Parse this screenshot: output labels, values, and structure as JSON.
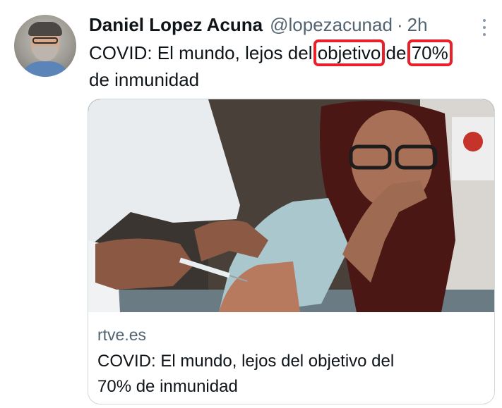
{
  "tweet": {
    "author": {
      "display_name": "Daniel Lopez Acuna",
      "handle": "@lopezacunad",
      "separator": "·",
      "time": "2h",
      "avatar_icon": "user-avatar"
    },
    "more_icon": "more-vertical-icon",
    "text": {
      "line1_part1": "COVID: El mundo, lejos del ",
      "line1_hl1": "objetivo",
      "line1_part2": " de ",
      "line1_hl2": "70%",
      "line2": "de inmunidad"
    },
    "highlight_color": "#e8202a"
  },
  "link_card": {
    "domain": "rtve.es",
    "title_line1": "COVID: El mundo, lejos del objetivo del",
    "title_line2": "70% de inmunidad",
    "image_icon": "vaccination-photo"
  }
}
